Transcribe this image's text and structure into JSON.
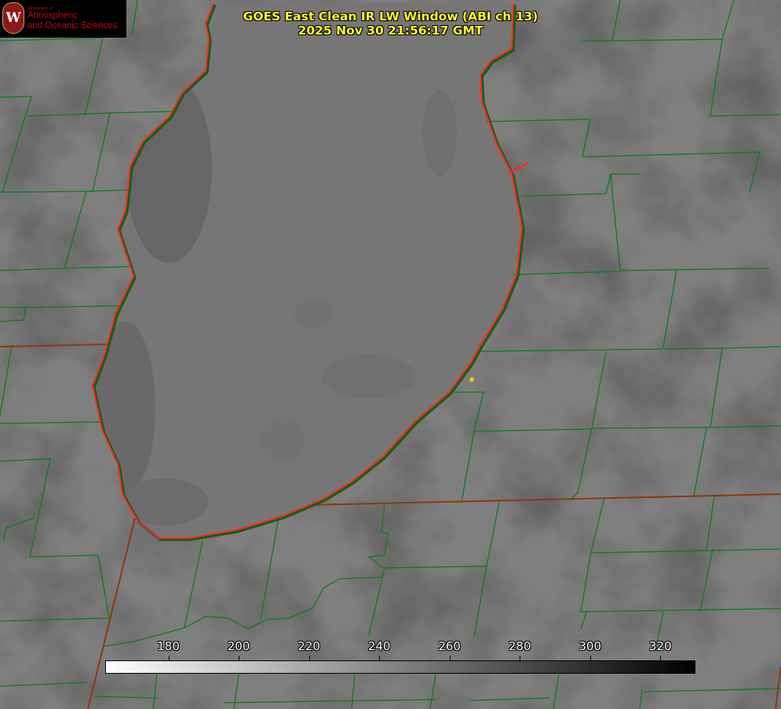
{
  "title": {
    "line1": "GOES East Clean IR LW Window (ABI ch 13)",
    "line2": "2025 Nov 30 21:56:17 GMT"
  },
  "logo": {
    "department": "Department of",
    "line1": "Atmospheric",
    "line2": "and Oceanic Sciences",
    "seal_letter": "W"
  },
  "colorbar": {
    "ticks": [
      "180",
      "200",
      "220",
      "240",
      "260",
      "280",
      "300",
      "320"
    ],
    "range": [
      162,
      330
    ],
    "gradient": [
      "#ffffff",
      "#000000"
    ]
  },
  "colors": {
    "background": "#7f7f7f",
    "lake_shore": "#ff2a1e",
    "county_lines": "#0b7d1e",
    "state_lines": "#8a3b0b",
    "title_text": "#ffff2a",
    "marker": "#e0d000"
  },
  "map_features": [
    "lake-michigan-shoreline",
    "county-boundaries",
    "state-boundary",
    "station-marker"
  ]
}
